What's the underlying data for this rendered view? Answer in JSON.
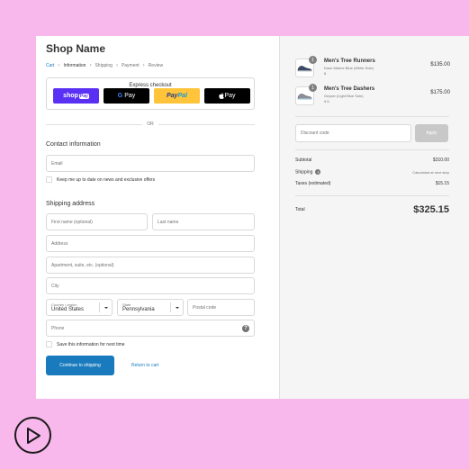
{
  "shop": {
    "name": "Shop Name"
  },
  "breadcrumb": [
    {
      "label": "Cart",
      "state": "link"
    },
    {
      "label": "Information",
      "state": "active"
    },
    {
      "label": "Shipping",
      "state": "pending"
    },
    {
      "label": "Payment",
      "state": "pending"
    },
    {
      "label": "Review",
      "state": "pending"
    }
  ],
  "express": {
    "title": "Express checkout",
    "shop_pay": {
      "shop": "shop",
      "pay": "Pay"
    },
    "google_pay": {
      "g": "G",
      "label": "Pay"
    },
    "paypal": {
      "pay": "Pay",
      "pal": "Pal"
    },
    "apple_pay": {
      "label": " Pay"
    }
  },
  "or_label": "OR",
  "contact": {
    "title": "Contact information",
    "email_placeholder": "Email",
    "newsletter_label": "Keep me up to date on news and exclusive offers"
  },
  "shipping": {
    "title": "Shipping address",
    "first_name": "First name (optional)",
    "last_name": "Last name",
    "address": "Address",
    "apartment": "Apartment, suite, etc. (optional)",
    "city": "City",
    "country_label": "Country / region",
    "country_value": "United States",
    "state_label": "State",
    "state_value": "Pennsylvania",
    "postal": "Postal code",
    "phone": "Phone",
    "phone_help": "?",
    "save_label": "Save this information for next time"
  },
  "actions": {
    "continue": "Continue to shipping",
    "return": "Return to cart"
  },
  "cart": {
    "items": [
      {
        "qty": "1",
        "name": "Men's Tree Runners",
        "variant": "Kauri Marine Blue (White Sole)",
        "size": "8",
        "price": "$135.00",
        "shoe_color": "#3a4a6b"
      },
      {
        "qty": "1",
        "name": "Men's Tree Dashers",
        "variant": "Geyser (Light Blue Sole)",
        "size": "9.5",
        "price": "$175.00",
        "shoe_color": "#8a8f99"
      }
    ],
    "discount_placeholder": "Discount code",
    "apply_label": "Apply",
    "subtotal_label": "Subtotal",
    "subtotal_value": "$310.00",
    "shipping_label": "Shipping",
    "shipping_help": "?",
    "shipping_value": "Calculated at next step",
    "taxes_label": "Taxes (estimated)",
    "taxes_value": "$15.15",
    "total_label": "Total",
    "total_value": "$325.15"
  },
  "colors": {
    "background": "#f8b8ec",
    "accent": "#197bbd",
    "shop_pay": "#5a31f4",
    "paypal": "#ffc439"
  }
}
